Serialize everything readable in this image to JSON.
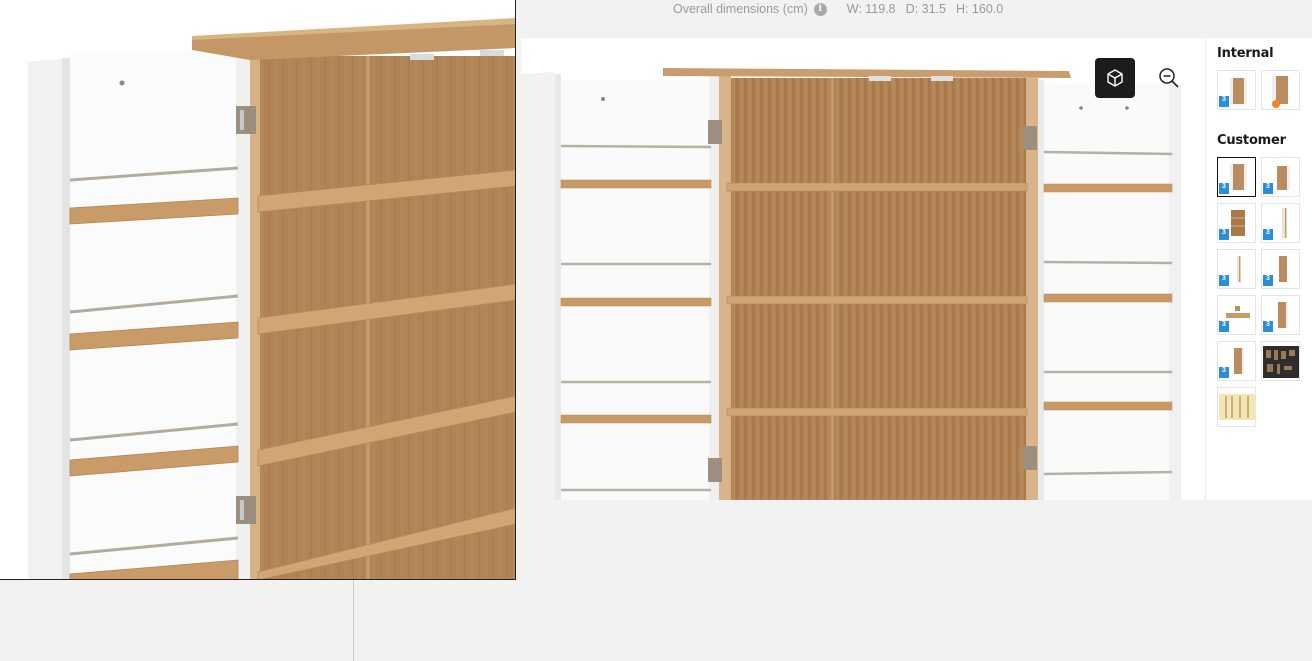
{
  "dimensions": {
    "label": "Overall dimensions (cm)",
    "info_icon": "info-icon",
    "width": "W: 119.8",
    "depth": "D: 31.5",
    "height": "H: 160.0"
  },
  "viewer": {
    "view_3d_icon": "cube-icon",
    "zoom_out_icon": "zoom-out-icon"
  },
  "panel": {
    "internal_title": "Internal",
    "customer_title": "Customer",
    "internal_thumbs": [
      "cabinet-open",
      "cabinet-blender"
    ],
    "customer_thumbs": [
      "cabinet-open-front",
      "cabinet-side",
      "cabinet-shelves",
      "side-panel",
      "side-panel-narrow",
      "side-panel-wood",
      "shelf-part",
      "door-panel",
      "door-panel-2",
      "parts-sheet",
      "material-swatch"
    ],
    "badge_text": "3",
    "colors": {
      "wood": "#b88a5a",
      "white": "#f7f7f7",
      "accent": "#2a8fd6",
      "dark": "#1c1c1c"
    }
  }
}
